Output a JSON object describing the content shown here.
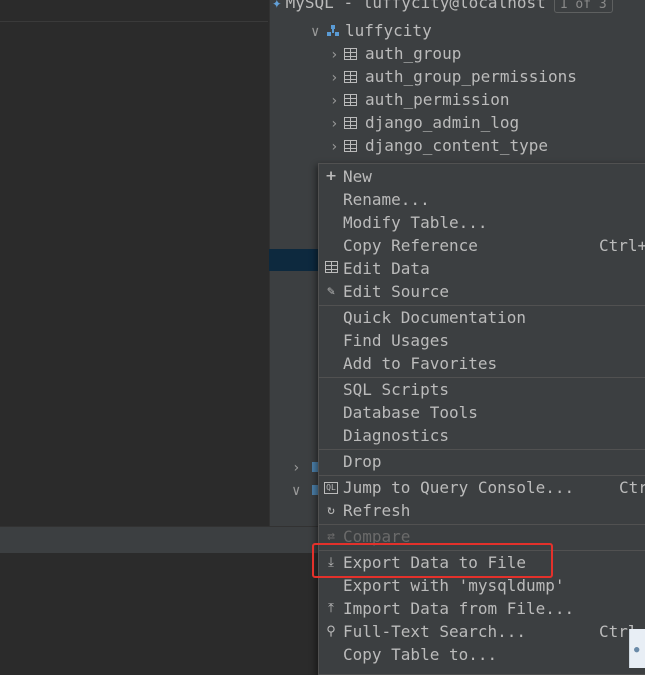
{
  "panel_header": {
    "connection_label": "MySQL - luffycity@localhost",
    "counter": "1 of 3"
  },
  "tree": {
    "schema": "luffycity",
    "tables": [
      "auth_group",
      "auth_group_permissions",
      "auth_permission",
      "django_admin_log",
      "django_content_type"
    ]
  },
  "context_menu": {
    "items": {
      "new": {
        "label": "New",
        "icon": "plus-icon"
      },
      "rename": {
        "label": "Rename..."
      },
      "modify_table": {
        "label": "Modify Table..."
      },
      "copy_reference": {
        "label": "Copy Reference",
        "shortcut": "Ctrl+"
      },
      "edit_data": {
        "label": "Edit Data",
        "icon": "table-grid-icon"
      },
      "edit_source": {
        "label": "Edit Source",
        "icon": "pencil-icon"
      },
      "quick_documentation": {
        "label": "Quick Documentation"
      },
      "find_usages": {
        "label": "Find Usages"
      },
      "add_to_favorites": {
        "label": "Add to Favorites"
      },
      "sql_scripts": {
        "label": "SQL Scripts"
      },
      "database_tools": {
        "label": "Database Tools"
      },
      "diagnostics": {
        "label": "Diagnostics"
      },
      "drop": {
        "label": "Drop"
      },
      "jump_to_query_console": {
        "label": "Jump to Query Console...",
        "shortcut": "Ctr",
        "icon": "query-console-icon"
      },
      "refresh": {
        "label": "Refresh",
        "icon": "refresh-icon"
      },
      "compare": {
        "label": "Compare",
        "icon": "compare-icon",
        "disabled": true
      },
      "export_data_to_file": {
        "label": "Export Data to File",
        "icon": "export-icon"
      },
      "export_with_mysqldump": {
        "label": "Export with 'mysqldump'"
      },
      "import_data_from_file": {
        "label": "Import Data from File...",
        "icon": "import-icon"
      },
      "full_text_search": {
        "label": "Full-Text Search...",
        "shortcut": "Ctrl",
        "icon": "search-icon"
      },
      "copy_table_to": {
        "label": "Copy Table to..."
      }
    }
  },
  "colors": {
    "editor_bg": "#2b2b2b",
    "panel_bg": "#3c3f41",
    "selection": "#0d293e",
    "highlight_box": "#e4312b",
    "text": "#bbbbbb"
  }
}
